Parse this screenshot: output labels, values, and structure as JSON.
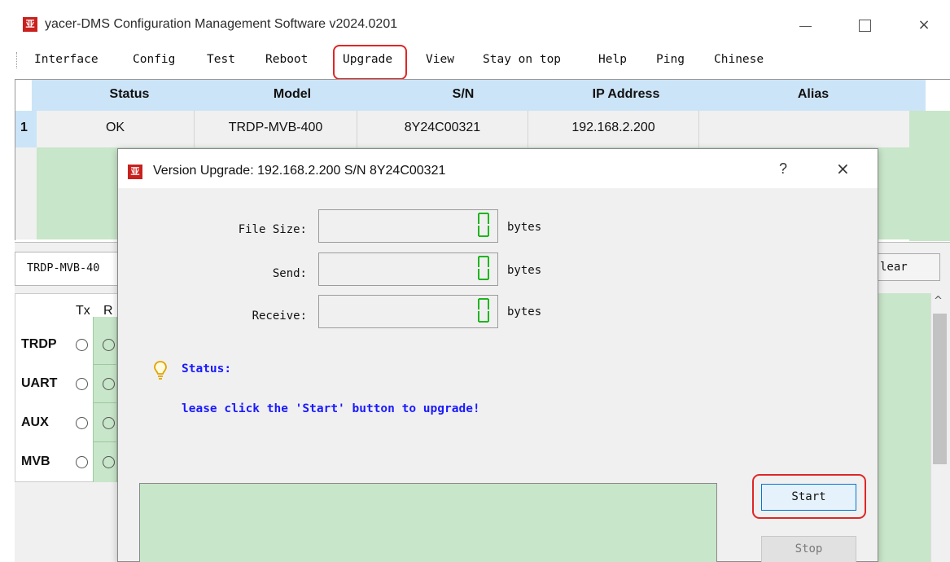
{
  "window": {
    "logo_text": "亚",
    "title": "yacer-DMS Configuration Management Software v2024.0201",
    "min_glyph": "",
    "max_glyph": "",
    "close_glyph": "×"
  },
  "menu": [
    "Interface",
    "Config",
    "Test",
    "Reboot",
    "Upgrade",
    "View",
    "Stay on top",
    "Help",
    "Ping",
    "Chinese"
  ],
  "device_table": {
    "headers": [
      "Status",
      "Model",
      "S/N",
      "IP Address",
      "Alias"
    ],
    "rows": [
      {
        "num": "1",
        "status": "OK",
        "model": "TRDP-MVB-400",
        "sn": "8Y24C00321",
        "ip": "192.168.2.200",
        "alias": ""
      }
    ]
  },
  "lower": {
    "device_name": "TRDP-MVB-40",
    "clear_label": "lear",
    "columns": [
      "Tx",
      "R"
    ],
    "interfaces": [
      "TRDP",
      "UART",
      "AUX",
      "MVB"
    ],
    "scroll_up": "^"
  },
  "dialog": {
    "logo_text": "亚",
    "title": "Version Upgrade: 192.168.2.200  S/N 8Y24C00321",
    "help": "?",
    "close": "×",
    "fields": [
      {
        "label": "File Size:",
        "value": 0,
        "unit": "bytes"
      },
      {
        "label": "Send:",
        "value": 0,
        "unit": "bytes"
      },
      {
        "label": "Receive:",
        "value": 0,
        "unit": "bytes"
      }
    ],
    "status_label": "Status:",
    "status_message": "lease click the 'Start' button to upgrade!",
    "start_label": "Start",
    "stop_label": "Stop"
  },
  "colors": {
    "accent_red": "#e02626",
    "header_blue": "#cce4f7",
    "panel_green": "#c8e6c9",
    "status_blue": "#1a1aff",
    "lcd_green": "#1fb51f"
  }
}
